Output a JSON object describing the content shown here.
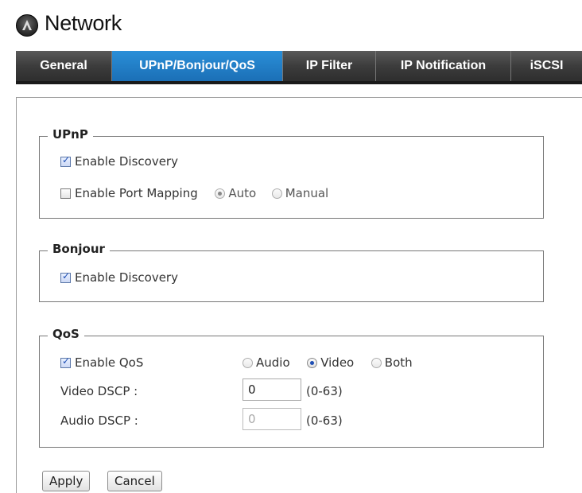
{
  "header": {
    "title": "Network",
    "icon": "app-logo-icon"
  },
  "tabs": [
    {
      "label": "General",
      "active": false
    },
    {
      "label": "UPnP/Bonjour/QoS",
      "active": true
    },
    {
      "label": "IP Filter",
      "active": false
    },
    {
      "label": "IP Notification",
      "active": false
    },
    {
      "label": "iSCSI",
      "active": false
    }
  ],
  "upnp": {
    "legend": "UPnP",
    "enable_discovery_label": "Enable Discovery",
    "enable_discovery_checked": true,
    "enable_port_mapping_label": "Enable Port Mapping",
    "enable_port_mapping_checked": false,
    "mapping_auto_label": "Auto",
    "mapping_manual_label": "Manual",
    "mapping_selected": "Auto"
  },
  "bonjour": {
    "legend": "Bonjour",
    "enable_discovery_label": "Enable Discovery",
    "enable_discovery_checked": true
  },
  "qos": {
    "legend": "QoS",
    "enable_qos_label": "Enable QoS",
    "enable_qos_checked": true,
    "mode_audio_label": "Audio",
    "mode_video_label": "Video",
    "mode_both_label": "Both",
    "mode_selected": "Video",
    "video_dscp_label": "Video DSCP :",
    "video_dscp_value": "0",
    "video_dscp_range": "(0-63)",
    "audio_dscp_label": "Audio DSCP :",
    "audio_dscp_value": "0",
    "audio_dscp_range": "(0-63)"
  },
  "actions": {
    "apply_label": "Apply",
    "cancel_label": "Cancel"
  },
  "colors": {
    "tab_active": "#1b6fb6",
    "tab_bar": "#3c3c3c"
  }
}
